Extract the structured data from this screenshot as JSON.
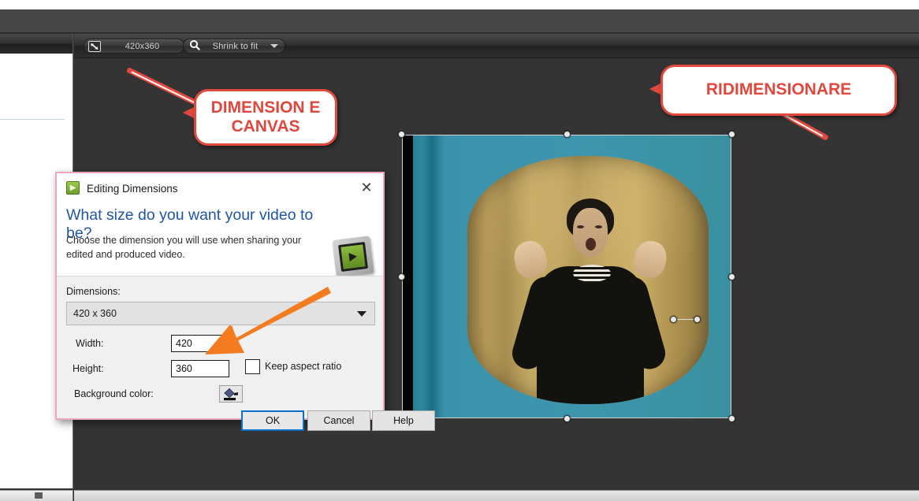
{
  "app": {
    "stage_toolbar": {
      "dimensions_button": {
        "label": "420x360",
        "icon": "resize-diagonal-icon"
      },
      "zoom_dropdown": {
        "label": "Shrink to fit",
        "icon": "magnifier-icon",
        "caret": "chevron-down-icon"
      }
    }
  },
  "annotations": {
    "callout_canvas": "DIMENSION E CANVAS",
    "callout_resize": "RIDIMENSIONARE",
    "callout_border_color": "#e1493f",
    "arrow_color": "#f47b20"
  },
  "dialog": {
    "title": "Editing Dimensions",
    "title_icon": "camtasia-green-icon",
    "close_label": "✕",
    "headline": "What size do you want your video to be?",
    "subtext": "Choose the dimension you will use when sharing your edited and produced video.",
    "logo_icon": "camtasia-filmstrip-icon",
    "dimensions_label": "Dimensions:",
    "dimensions_value": "420 x 360",
    "width_label": "Width:",
    "width_value": "420",
    "height_label": "Height:",
    "height_value": "360",
    "keep_aspect_label": "Keep aspect ratio",
    "keep_aspect_checked": false,
    "background_color_label": "Background color:",
    "background_color_icon": "paint-bucket-icon",
    "background_color_swatch": "#000000",
    "buttons": {
      "ok": "OK",
      "cancel": "Cancel",
      "help": "Help"
    },
    "accent_focus_color": "#0a70c8",
    "border_color": "#eea6bd",
    "headline_color": "#1f56a5"
  },
  "canvas": {
    "selection_handles": 8,
    "rotation_handle": true,
    "media_description": "vintage television clip showing a woman gesturing"
  }
}
